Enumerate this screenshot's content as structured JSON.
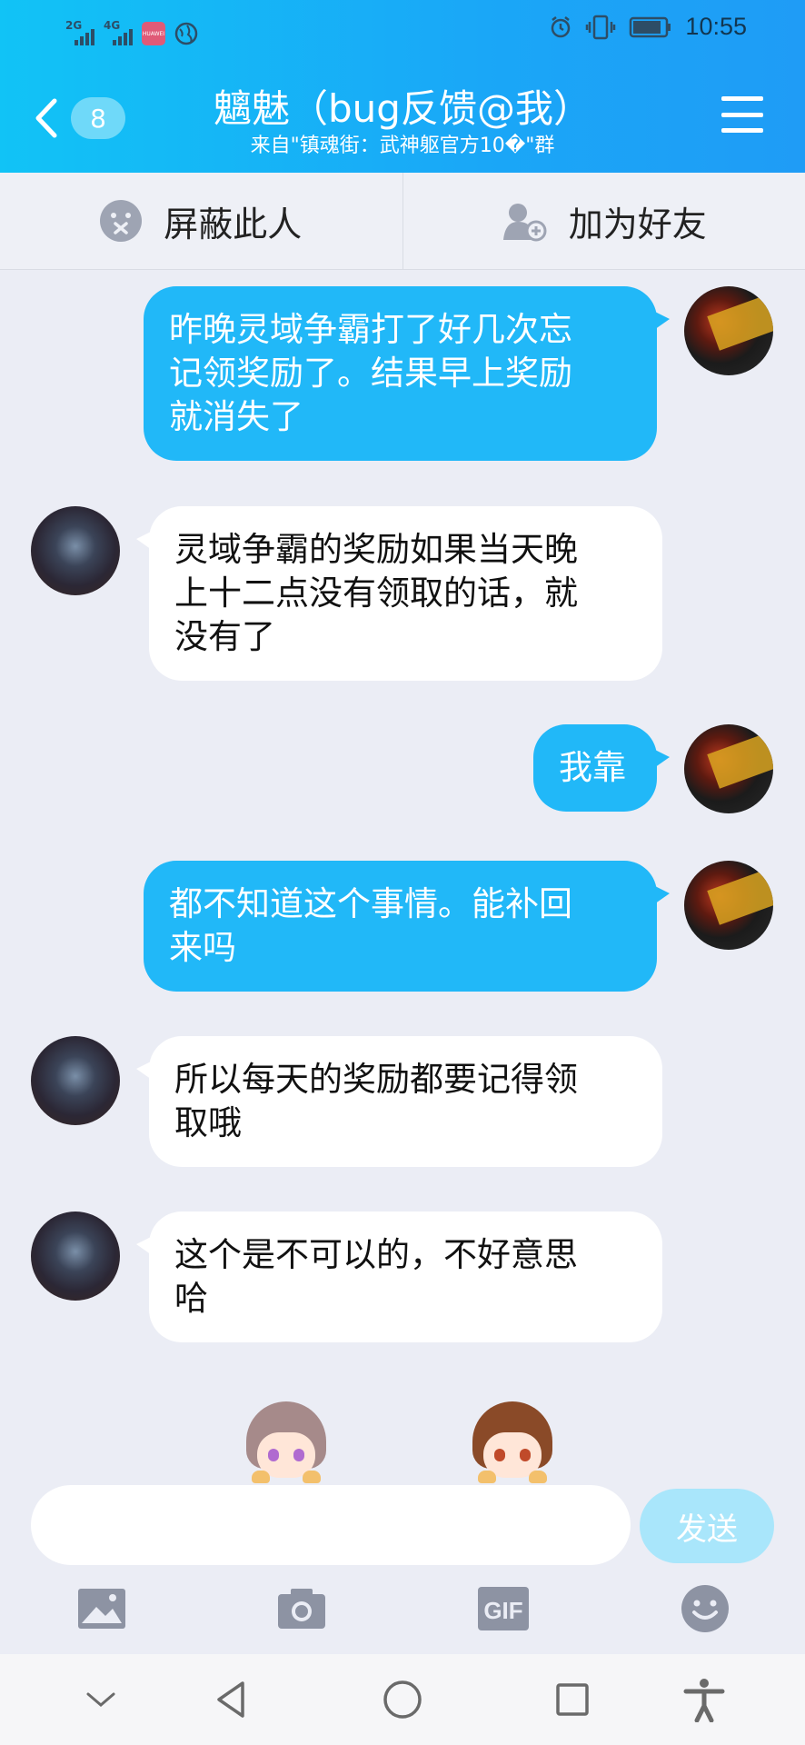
{
  "status_bar": {
    "signal1_label": "2G",
    "signal2_label": "4G",
    "huawei_label": "HUAWEI",
    "time": "10:55"
  },
  "header": {
    "unread_count": "8",
    "title": "魑魅（bug反馈@我）",
    "subtitle": "来自\"镇魂街：武神躯官方10�\"群"
  },
  "actions": {
    "block_label": "屏蔽此人",
    "add_friend_label": "加为好友"
  },
  "messages": [
    {
      "side": "me",
      "text_lines": [
        "昨晚灵域争霸打了好几次忘",
        "记领奖励了。结果早上奖励",
        "就消失了"
      ]
    },
    {
      "side": "other",
      "text_lines": [
        "灵域争霸的奖励如果当天晚",
        "上十二点没有领取的话，就",
        "没有了"
      ]
    },
    {
      "side": "me",
      "text_lines": [
        "我靠"
      ]
    },
    {
      "side": "me",
      "text_lines": [
        "都不知道这个事情。能补回",
        "来吗"
      ]
    },
    {
      "side": "other",
      "text_lines": [
        "所以每天的奖励都要记得领",
        "取哦"
      ]
    },
    {
      "side": "other",
      "text_lines": [
        "这个是不可以的，不好意思",
        "哈"
      ]
    }
  ],
  "input": {
    "value": "",
    "placeholder": "",
    "send_label": "发送"
  },
  "toolbar": {
    "gif_label": "GIF"
  },
  "colors": {
    "header_start": "#11c3f6",
    "header_end": "#1f9cf6",
    "my_bubble": "#21b8f8",
    "other_bubble": "#ffffff",
    "background": "#ebedf5",
    "send_button": "#a9e6fb"
  }
}
